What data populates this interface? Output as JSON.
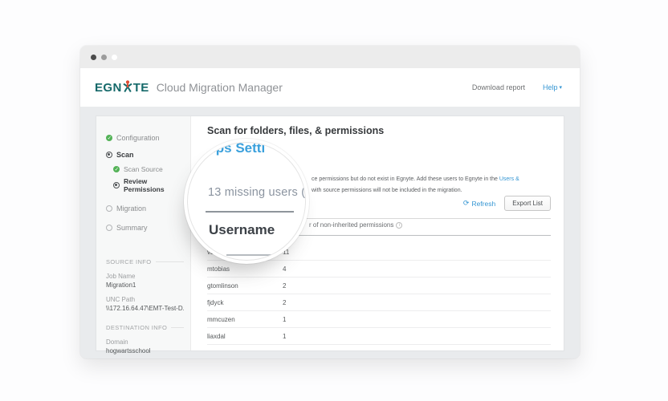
{
  "header": {
    "logo_left": "EGN",
    "logo_right": "TE",
    "app_title": "Cloud Migration Manager",
    "download_report": "Download report",
    "help_label": "Help",
    "help_caret": "▾"
  },
  "sidebar": {
    "steps": {
      "configuration": "Configuration",
      "scan": "Scan",
      "scan_source": "Scan Source",
      "review_permissions": "Review Permissions",
      "migration": "Migration",
      "summary": "Summary"
    },
    "source_info_title": "SOURCE INFO",
    "job_name_label": "Job Name",
    "job_name_value": "Migration1",
    "unc_path_label": "UNC Path",
    "unc_path_value": "\\\\172.16.64.47\\EMT-Test-D...",
    "destination_info_title": "DESTINATION INFO",
    "domain_label": "Domain",
    "domain_value": "hogwartsschool"
  },
  "main": {
    "heading": "Scan for folders, files, & permissions",
    "description_line1_text": "ce permissions but do not exist in Egnyte. Add these users to Egnyte in the ",
    "description_line1_link": "Users &",
    "description_line2_text": "with source permissions will not be included in the migration.",
    "refresh_label": "Refresh",
    "export_label": "Export List",
    "table": {
      "col2_header_fragment": "r of non-inherited permissions",
      "rows": [
        {
          "username": "vbapte",
          "count": "11"
        },
        {
          "username": "mtobias",
          "count": "4"
        },
        {
          "username": "gtomlinson",
          "count": "2"
        },
        {
          "username": "fjdyck",
          "count": "2"
        },
        {
          "username": "mmcuzen",
          "count": "1"
        },
        {
          "username": "liaxdal",
          "count": "1"
        }
      ]
    }
  },
  "magnifier": {
    "clipped_link_text": "oups Setti",
    "headline": "13 missing users (",
    "column_header": "Username"
  },
  "colors": {
    "accent_blue": "#3596d3",
    "brand_teal": "#15696a",
    "brand_red": "#df4b32",
    "success_green": "#53b257"
  }
}
